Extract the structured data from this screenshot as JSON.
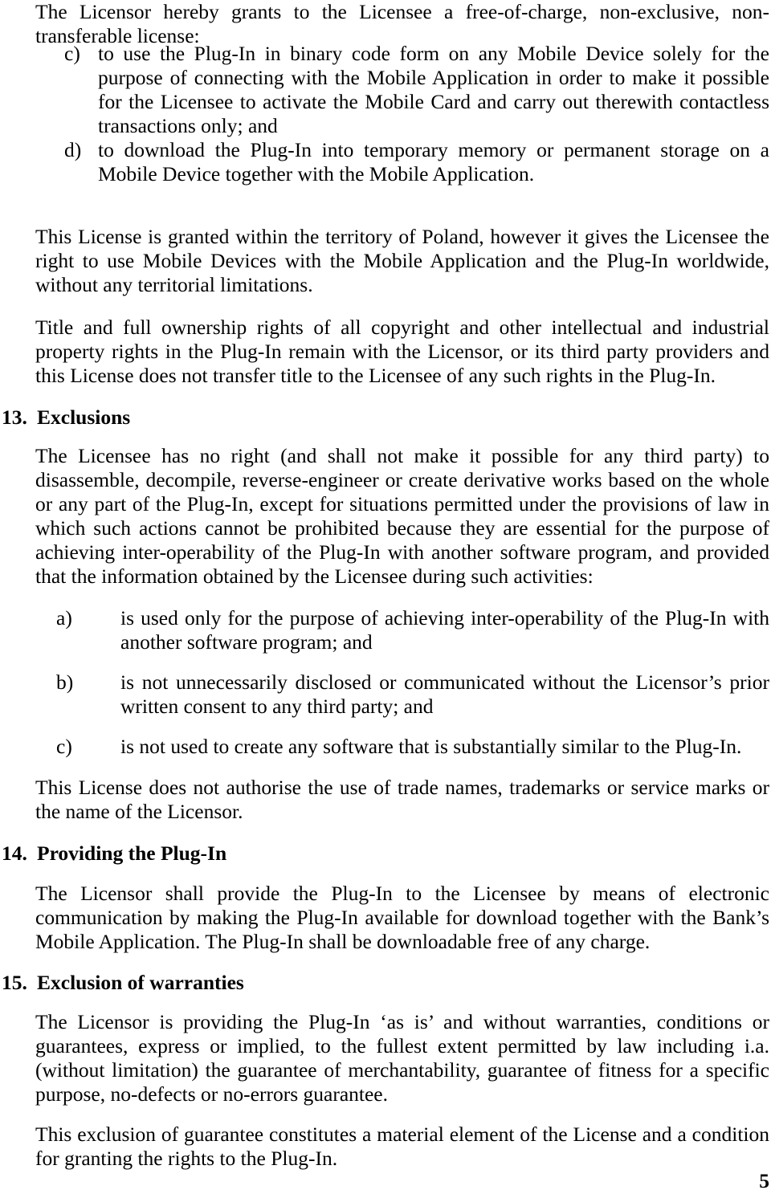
{
  "document": {
    "page_number": "5",
    "page_label": "5"
  },
  "content": {
    "lead_paragraph": "The Licensor hereby grants to the Licensee a free-of-charge, non-exclusive, non-transferable license:",
    "license_items": [
      {
        "marker": "c)",
        "text": "to use the Plug-In in binary code form on any Mobile Device solely for the purpose of connecting with the Mobile Application in order to make it possible for the Licensee to activate the Mobile Card and carry out therewith contactless transactions only; and"
      },
      {
        "marker": "d)",
        "text": "to download the Plug-In into temporary memory or permanent storage on a Mobile Device together with the Mobile Application."
      }
    ],
    "territory_paragraph": "This License is granted within the territory of Poland, however it gives the Licensee the right to use Mobile Devices with the Mobile Application and the Plug-In worldwide, without any territorial limitations.",
    "title_paragraph": "Title and full ownership rights of all copyright and other intellectual and industrial property rights in the Plug-In remain with the Licensor, or its third party providers and this License does not transfer title to the Licensee of any such rights in the Plug-In."
  },
  "sections": [
    {
      "number": "13.",
      "title": "Exclusions",
      "body": "The Licensee has no right (and shall not make it possible for any third party) to disassemble, decompile, reverse-engineer or create derivative works based on the whole or any part of the Plug-In, except for situations permitted under the provisions of law in which such actions cannot be prohibited because they are essential for the purpose of achieving inter-operability of the Plug-In with another software program, and provided that the information obtained by the Licensee during such activities:",
      "items": [
        {
          "marker": "a)",
          "text": "is used only for the purpose of achieving inter-operability of the Plug-In with another software program; and"
        },
        {
          "marker": "b)",
          "text": "is not unnecessarily disclosed or communicated without the Licensor’s prior written consent to any third party; and"
        },
        {
          "marker": "c)",
          "text": "is not used to create any software that is substantially similar to the Plug-In."
        }
      ],
      "closing": "This License does not authorise the use of trade names, trademarks or service marks or the name of the Licensor."
    },
    {
      "number": "14.",
      "title": "Providing the Plug-In",
      "body": "The Licensor shall provide the Plug-In to the Licensee by means of electronic communication by making the Plug-In available for download together with the Bank’s Mobile Application. The Plug-In shall be downloadable free of any charge."
    },
    {
      "number": "15.",
      "title": "Exclusion of warranties",
      "body": "The Licensor is providing the Plug-In ‘as is’ and without warranties, conditions or guarantees, express or implied, to the fullest extent permitted by law including i.a. (without limitation) the guarantee of merchantability, guarantee of fitness for a specific purpose, no-defects or no-errors guarantee.",
      "closing": "This exclusion of guarantee constitutes a material element of the License and a condition for granting the rights to the Plug-In."
    }
  ]
}
